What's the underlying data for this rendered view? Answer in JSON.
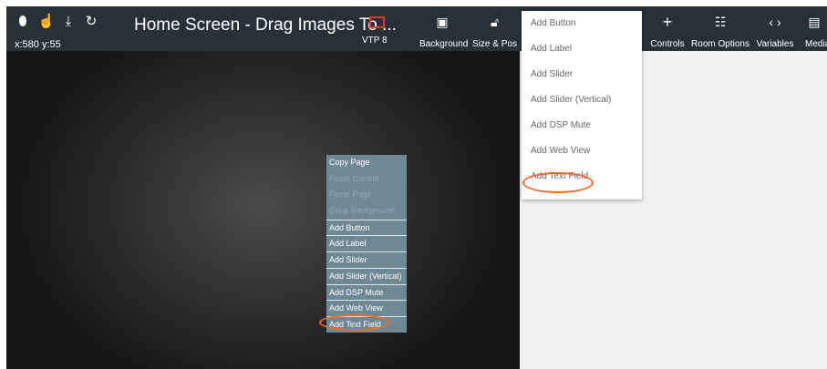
{
  "header": {
    "title": "Home Screen - Drag Images To ...",
    "coords": "x:580 y:55",
    "device_label": "VTP 8",
    "accent_color": "#e53935",
    "left_icons": [
      "tablet-icon",
      "touch-icon",
      "download-icon",
      "sync-icon"
    ],
    "buttons": [
      {
        "label": "Background",
        "icon": "▣"
      },
      {
        "label": "Size & Pos",
        "icon": "⧈"
      },
      {
        "label": "Controls",
        "icon": "+"
      },
      {
        "label": "Room Options",
        "icon": "⚙"
      },
      {
        "label": "Variables",
        "icon": "‹›"
      },
      {
        "label": "Media",
        "icon": "▤"
      }
    ]
  },
  "context_menu": {
    "items": [
      {
        "label": "Copy Page",
        "enabled": true
      },
      {
        "label": "Paste Control",
        "enabled": false
      },
      {
        "label": "Paste Page",
        "enabled": false
      },
      {
        "label": "Clear Background",
        "enabled": false
      },
      {
        "label": "Add Button",
        "enabled": true
      },
      {
        "label": "Add Label",
        "enabled": true
      },
      {
        "label": "Add Slider",
        "enabled": true
      },
      {
        "label": "Add Slider (Vertical)",
        "enabled": true
      },
      {
        "label": "Add DSP Mute",
        "enabled": true
      },
      {
        "label": "Add Web View",
        "enabled": true
      },
      {
        "label": "Add Text Field",
        "enabled": true
      }
    ]
  },
  "controls_dropdown": {
    "items": [
      "Add Button",
      "Add Label",
      "Add Slider",
      "Add Slider (Vertical)",
      "Add DSP Mute",
      "Add Web View",
      "Add Text Field"
    ]
  },
  "highlight_color": "#f26a2a"
}
